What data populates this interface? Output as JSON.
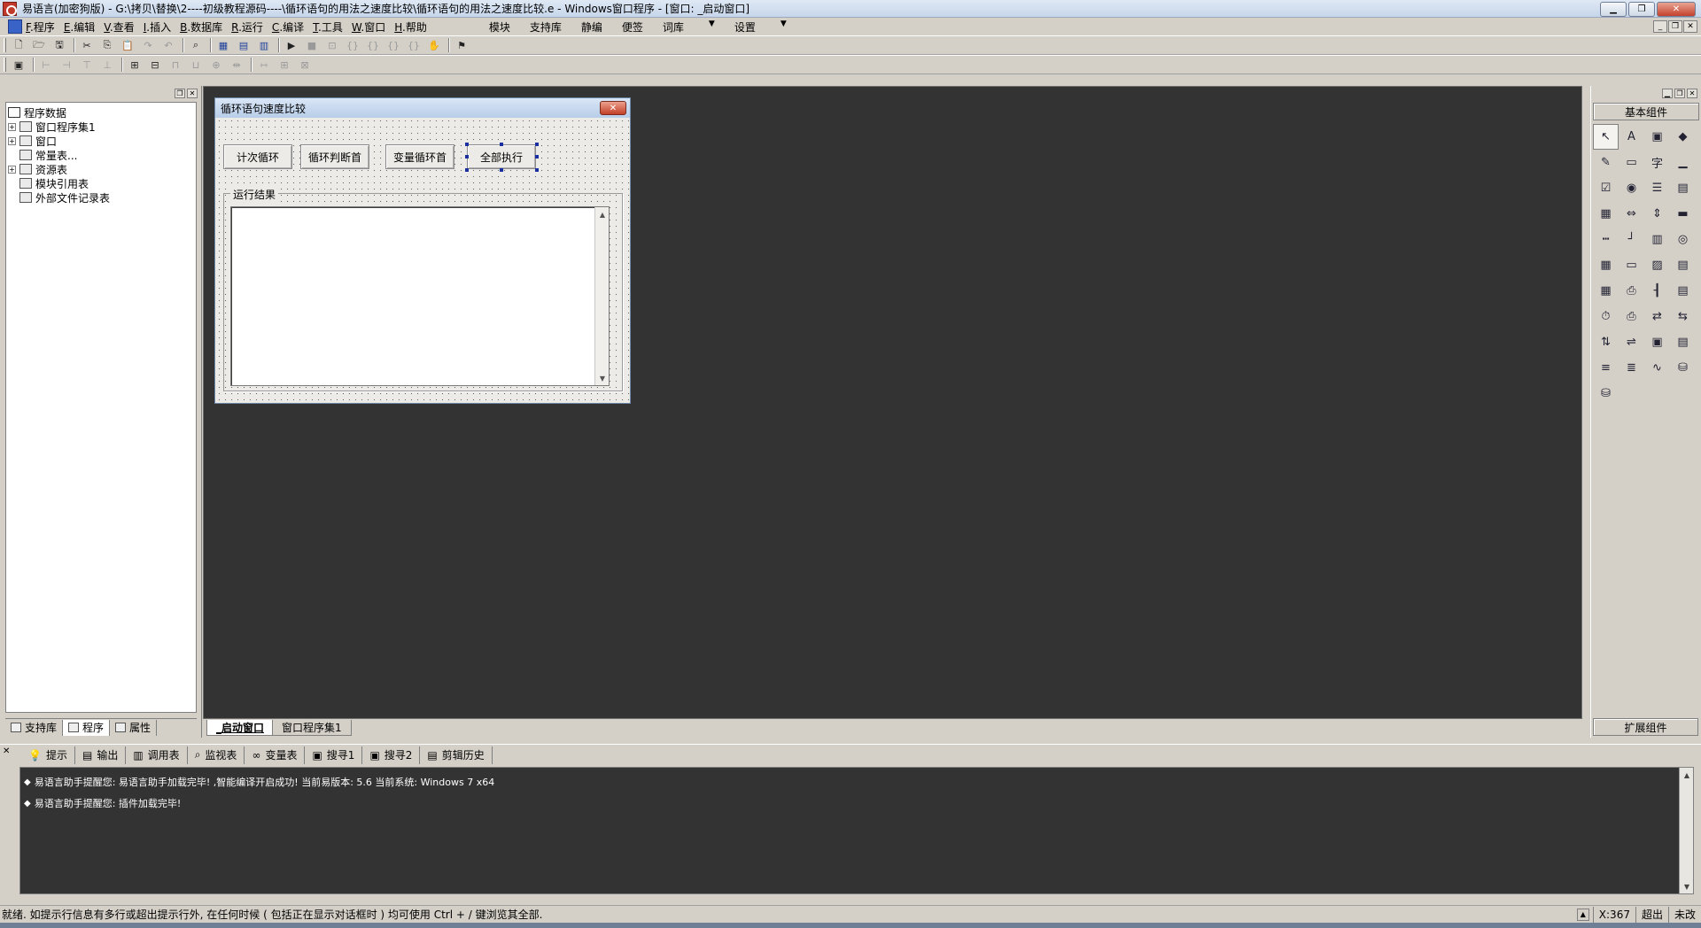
{
  "window": {
    "title": "易语言(加密狗版) - G:\\拷贝\\替换\\2----初级教程源码----\\循环语句的用法之速度比较\\循环语句的用法之速度比较.e - Windows窗口程序 - [窗口: _启动窗口]",
    "minimize": "▁",
    "maximize": "❐",
    "close": "✕"
  },
  "menu": {
    "items": [
      {
        "key": "F",
        "label": ".程序"
      },
      {
        "key": "E",
        "label": ".编辑"
      },
      {
        "key": "V",
        "label": ".查看"
      },
      {
        "key": "I",
        "label": ".插入"
      },
      {
        "key": "B",
        "label": ".数据库"
      },
      {
        "key": "R",
        "label": ".运行"
      },
      {
        "key": "C",
        "label": ".编译"
      },
      {
        "key": "T",
        "label": ".工具"
      },
      {
        "key": "W",
        "label": ".窗口"
      },
      {
        "key": "H",
        "label": ".帮助"
      }
    ],
    "extra": [
      "模块",
      "支持库",
      "静编",
      "便签",
      "词库",
      "设置"
    ],
    "mdi": [
      "_",
      "❐",
      "✕"
    ]
  },
  "left_panel": {
    "tree": {
      "root": "程序数据",
      "items": [
        {
          "label": "窗口程序集1",
          "toggle": "+"
        },
        {
          "label": "窗口",
          "toggle": "+"
        },
        {
          "label": "常量表...",
          "toggle": ""
        },
        {
          "label": "资源表",
          "toggle": "+"
        },
        {
          "label": "模块引用表",
          "toggle": ""
        },
        {
          "label": "外部文件记录表",
          "toggle": ""
        }
      ]
    },
    "tabs": [
      "支持库",
      "程序",
      "属性"
    ]
  },
  "form": {
    "title": "循环语句速度比较",
    "close": "✕",
    "buttons": [
      "计次循环",
      "循环判断首",
      "变量循环首",
      "全部执行"
    ],
    "group_label": "运行结果",
    "result_text": "",
    "scroll_up": "▲",
    "scroll_down": "▼"
  },
  "workspace_tabs": [
    "_启动窗口",
    "窗口程序集1"
  ],
  "right_panel": {
    "section_title": "基本组件",
    "footer": "扩展组件",
    "tools": [
      {
        "name": "pointer-tool-icon",
        "glyph": "↖"
      },
      {
        "name": "label-tool-icon",
        "glyph": "A"
      },
      {
        "name": "picture-box-tool-icon",
        "glyph": "▣"
      },
      {
        "name": "shape-tool-icon",
        "glyph": "◆"
      },
      {
        "name": "edit-box-tool-icon",
        "glyph": "✎"
      },
      {
        "name": "button-tool-icon",
        "glyph": "▭"
      },
      {
        "name": "text-tool-icon",
        "glyph": "字"
      },
      {
        "name": "line-tool-icon",
        "glyph": "▁"
      },
      {
        "name": "checkbox-tool-icon",
        "glyph": "☑"
      },
      {
        "name": "radio-tool-icon",
        "glyph": "◉"
      },
      {
        "name": "listbox-tool-icon",
        "glyph": "☰"
      },
      {
        "name": "combobox-tool-icon",
        "glyph": "▤"
      },
      {
        "name": "tab-tool-icon",
        "glyph": "▦"
      },
      {
        "name": "hscroll-tool-icon",
        "glyph": "⇔"
      },
      {
        "name": "vscroll-tool-icon",
        "glyph": "⇕"
      },
      {
        "name": "progress-tool-icon",
        "glyph": "▬"
      },
      {
        "name": "slider-tool-icon",
        "glyph": "┅"
      },
      {
        "name": "frame-tool-icon",
        "glyph": "┘"
      },
      {
        "name": "gauge-tool-icon",
        "glyph": "▥"
      },
      {
        "name": "image-list-tool-icon",
        "glyph": "◎"
      },
      {
        "name": "grid-tool-icon",
        "glyph": "▦"
      },
      {
        "name": "date-tool-icon",
        "glyph": "▭"
      },
      {
        "name": "dir-tool-icon",
        "glyph": "▨"
      },
      {
        "name": "file-tool-icon",
        "glyph": "▤"
      },
      {
        "name": "calendar-tool-icon",
        "glyph": "▦"
      },
      {
        "name": "printer-tool-icon",
        "glyph": "⎙"
      },
      {
        "name": "toolbar-tool-icon",
        "glyph": "┨"
      },
      {
        "name": "table-tool-icon",
        "glyph": "▤"
      },
      {
        "name": "timer-tool-icon",
        "glyph": "⏱"
      },
      {
        "name": "print-preview-tool-icon",
        "glyph": "⎙"
      },
      {
        "name": "net-send-tool-icon",
        "glyph": "⇄"
      },
      {
        "name": "net-recv-tool-icon",
        "glyph": "⇆"
      },
      {
        "name": "client-tool-icon",
        "glyph": "⇅"
      },
      {
        "name": "server-tool-icon",
        "glyph": "⇌"
      },
      {
        "name": "ole-tool-icon",
        "glyph": "▣"
      },
      {
        "name": "db-grid-tool-icon",
        "glyph": "▤"
      },
      {
        "name": "db-nav-tool-icon",
        "glyph": "≡"
      },
      {
        "name": "db-provider-tool-icon",
        "glyph": "≣"
      },
      {
        "name": "chart-tool-icon",
        "glyph": "∿"
      },
      {
        "name": "odbc-tool-icon",
        "glyph": "⛁"
      },
      {
        "name": "odbc2-tool-icon",
        "glyph": "⛁"
      }
    ]
  },
  "output": {
    "tabs": [
      {
        "icon": "bulb-icon",
        "glyph": "💡",
        "label": "提示"
      },
      {
        "icon": "output-icon",
        "glyph": "▤",
        "label": "输出"
      },
      {
        "icon": "call-table-icon",
        "glyph": "▥",
        "label": "调用表"
      },
      {
        "icon": "watch-icon",
        "glyph": "⌕",
        "label": "监视表"
      },
      {
        "icon": "variable-icon",
        "glyph": "∞",
        "label": "变量表"
      },
      {
        "icon": "search1-icon",
        "glyph": "▣",
        "label": "搜寻1"
      },
      {
        "icon": "search2-icon",
        "glyph": "▣",
        "label": "搜寻2"
      },
      {
        "icon": "clipboard-icon",
        "glyph": "▤",
        "label": "剪辑历史"
      }
    ],
    "lines": [
      "易语言助手提醒您: 易语言助手加载完毕! ,智能编译开启成功! 当前易版本: 5.6 当前系统: Windows 7 x64",
      "易语言助手提醒您: 插件加载完毕!"
    ]
  },
  "status": {
    "text": "就绪. 如提示行信息有多行或超出提示行外, 在任何时候 ( 包括正在显示对话框时 ) 均可使用 Ctrl + / 键浏览其全部.",
    "coord": "X:367",
    "mode": "超出",
    "modified": "未改"
  }
}
